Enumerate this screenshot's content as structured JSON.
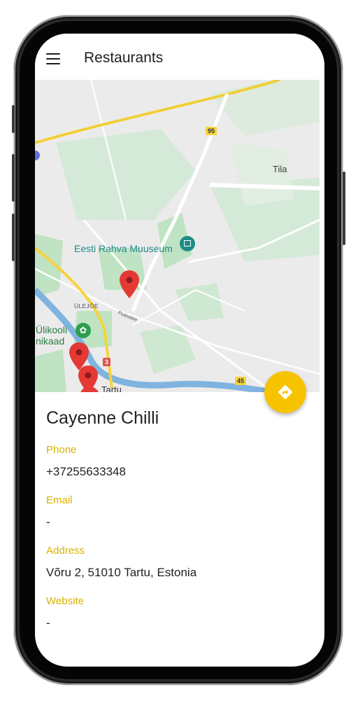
{
  "app_bar": {
    "title": "Restaurants",
    "menu_icon": "menu-icon"
  },
  "map": {
    "labels": {
      "tila": "Tila",
      "museum": "Eesti Rahva Muuseum",
      "district": "ÜLEJÕE",
      "street": "Puiestee",
      "botanic_line1": "Ülikooli",
      "botanic_line2": "nikaad",
      "city": "Tartu"
    },
    "road_shields": [
      "95",
      "45",
      "3"
    ],
    "marker_count": 4,
    "colors": {
      "marker": "#e53935",
      "highway": "#f6d33c",
      "water": "#7fb3e0",
      "park": "#bfe3c3"
    }
  },
  "fab": {
    "icon": "directions-icon",
    "color": "#f7c300"
  },
  "restaurant": {
    "name": "Cayenne Chilli",
    "phone_label": "Phone",
    "phone": "+37255633348",
    "email_label": "Email",
    "email": "-",
    "address_label": "Address",
    "address": "Võru 2, 51010 Tartu, Estonia",
    "website_label": "Website",
    "website": "-"
  },
  "accent_color": "#d8b400"
}
